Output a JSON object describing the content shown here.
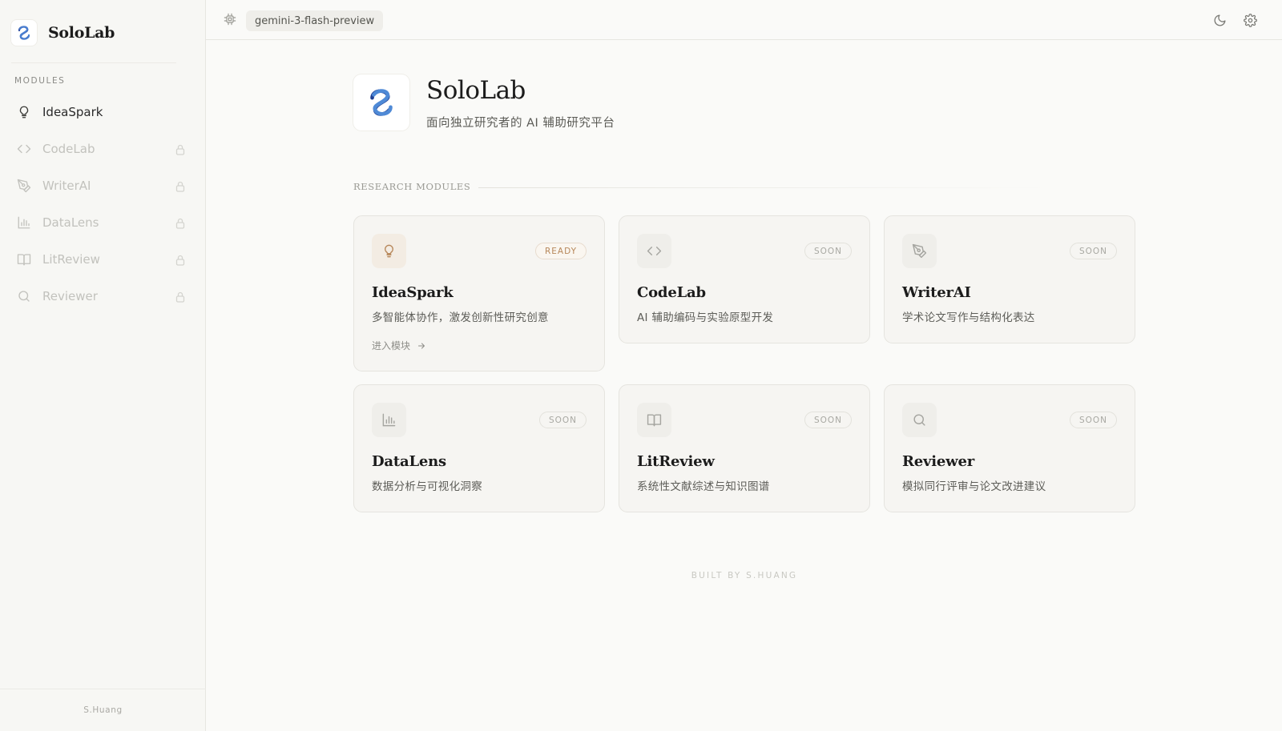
{
  "sidebar": {
    "brand": "SoloLab",
    "section_label": "MODULES",
    "items": [
      {
        "label": "IdeaSpark",
        "icon": "lightbulb-icon",
        "locked": false
      },
      {
        "label": "CodeLab",
        "icon": "code-icon",
        "locked": true
      },
      {
        "label": "WriterAI",
        "icon": "pen-tool-icon",
        "locked": true
      },
      {
        "label": "DataLens",
        "icon": "bar-chart-icon",
        "locked": true
      },
      {
        "label": "LitReview",
        "icon": "book-open-icon",
        "locked": true
      },
      {
        "label": "Reviewer",
        "icon": "search-icon",
        "locked": true
      }
    ],
    "footer": "S.Huang"
  },
  "topbar": {
    "model": "gemini-3-flash-preview"
  },
  "hero": {
    "title": "SoloLab",
    "subtitle": "面向独立研究者的 AI 辅助研究平台"
  },
  "section": {
    "label": "RESEARCH MODULES"
  },
  "cards": [
    {
      "title": "IdeaSpark",
      "desc": "多智能体协作，激发创新性研究创意",
      "badge": "READY",
      "enter": "进入模块",
      "icon": "lightbulb-icon"
    },
    {
      "title": "CodeLab",
      "desc": "AI 辅助编码与实验原型开发",
      "badge": "SOON",
      "icon": "code-icon"
    },
    {
      "title": "WriterAI",
      "desc": "学术论文写作与结构化表达",
      "badge": "SOON",
      "icon": "pen-tool-icon"
    },
    {
      "title": "DataLens",
      "desc": "数据分析与可视化洞察",
      "badge": "SOON",
      "icon": "bar-chart-icon"
    },
    {
      "title": "LitReview",
      "desc": "系统性文献综述与知识图谱",
      "badge": "SOON",
      "icon": "book-open-icon"
    },
    {
      "title": "Reviewer",
      "desc": "模拟同行评审与论文改进建议",
      "badge": "SOON",
      "icon": "search-icon"
    }
  ],
  "footer": "BUILT BY S.HUANG",
  "colors": {
    "background": "#fafaf8",
    "ready_accent": "#b7875a",
    "logo_blue": "#2d4fa3"
  }
}
